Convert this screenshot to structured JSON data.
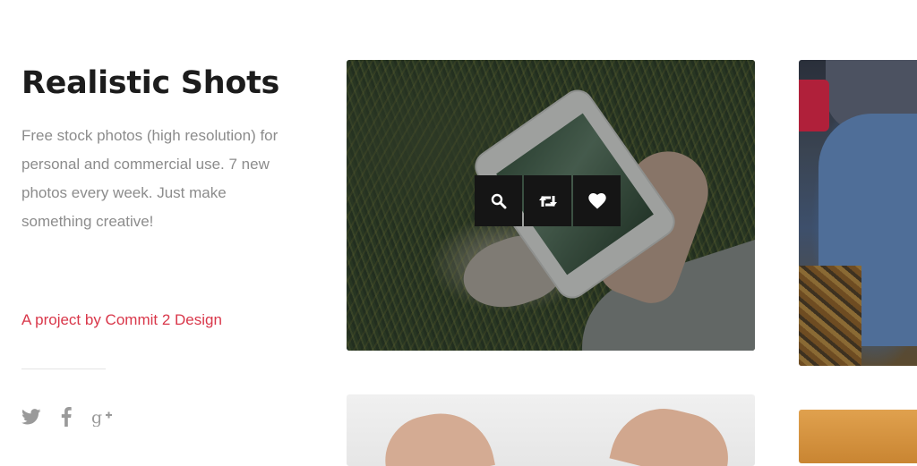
{
  "sidebar": {
    "title": "Realistic Shots",
    "description": "Free stock photos (high resolution) for personal and commercial use. 7 new photos every week. Just make something creative!",
    "credit_link": "A project by Commit 2 Design",
    "social": [
      {
        "icon": "twitter-icon"
      },
      {
        "icon": "facebook-icon"
      },
      {
        "icon": "google-plus-icon"
      }
    ]
  },
  "gallery": {
    "hover_actions": [
      {
        "icon": "search-icon"
      },
      {
        "icon": "retweet-icon"
      },
      {
        "icon": "heart-icon"
      }
    ]
  },
  "colors": {
    "accent": "#d9374a",
    "title": "#1c1c1c",
    "body_text": "#8c8c8c",
    "toolbar_bg": "#151515"
  }
}
